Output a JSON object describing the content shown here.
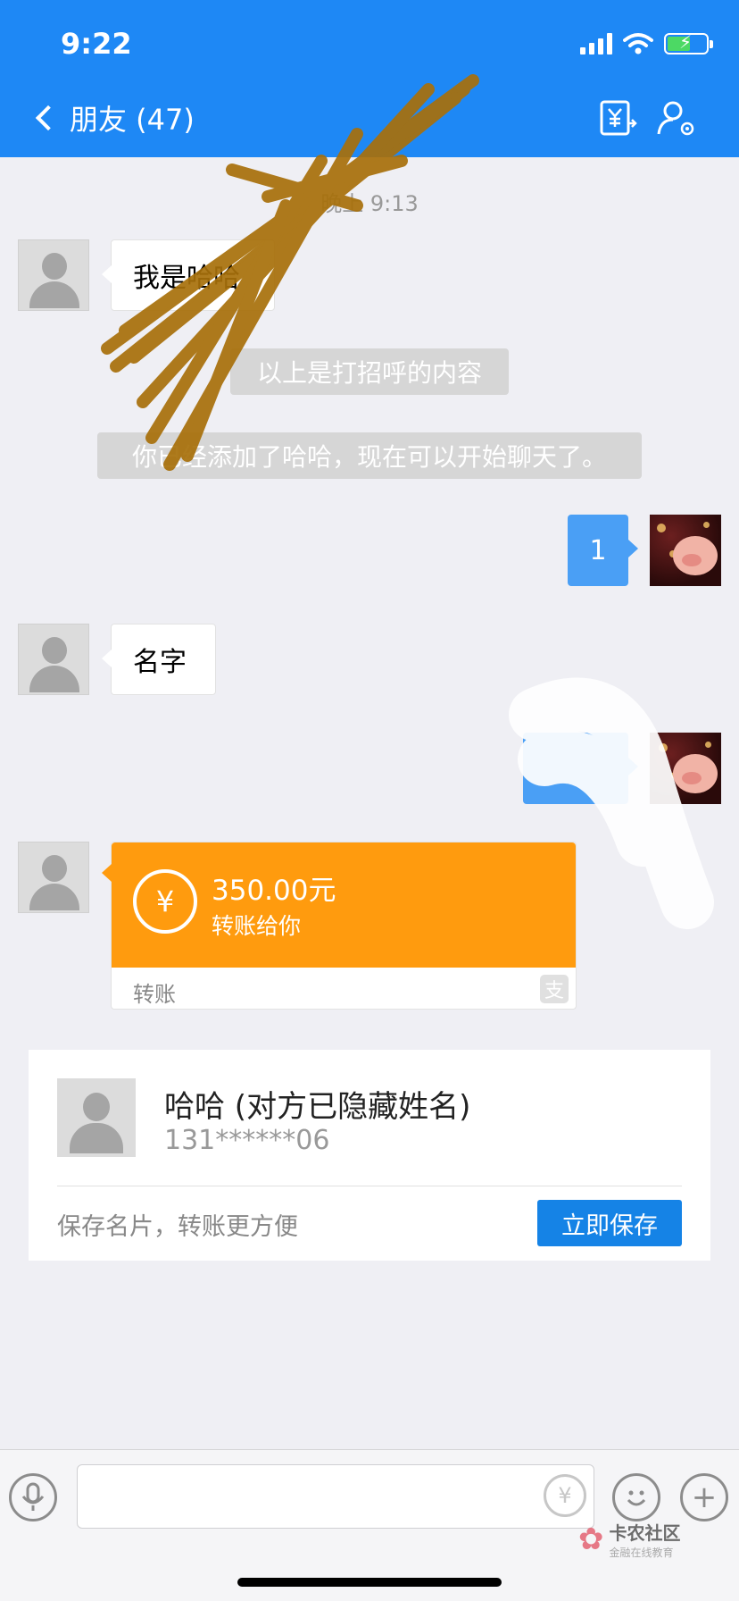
{
  "status": {
    "time": "9:22"
  },
  "nav": {
    "title": "朋友 (47)"
  },
  "chat": {
    "timestamp": "晚上 9:13",
    "messages": {
      "greeting": "我是哈哈",
      "system_hello": "以上是打招呼的内容",
      "system_added": "你已经添加了哈哈，现在可以开始聊天了。",
      "sent_1": "1",
      "name": "名字"
    },
    "transfer": {
      "amount": "350.00元",
      "description": "转账给你",
      "footer": "转账"
    }
  },
  "save_card": {
    "name": "哈哈 (对方已隐藏姓名)",
    "phone": "131******06",
    "hint": "保存名片，转账更方便",
    "button": "立即保存"
  },
  "watermark": {
    "title": "卡农社区",
    "subtitle": "金融在线教育"
  },
  "colors": {
    "nav_blue": "#1e88f5",
    "sent_bubble": "#4a9ff5",
    "transfer_orange": "#ff9b0e",
    "save_button": "#1583e6"
  }
}
